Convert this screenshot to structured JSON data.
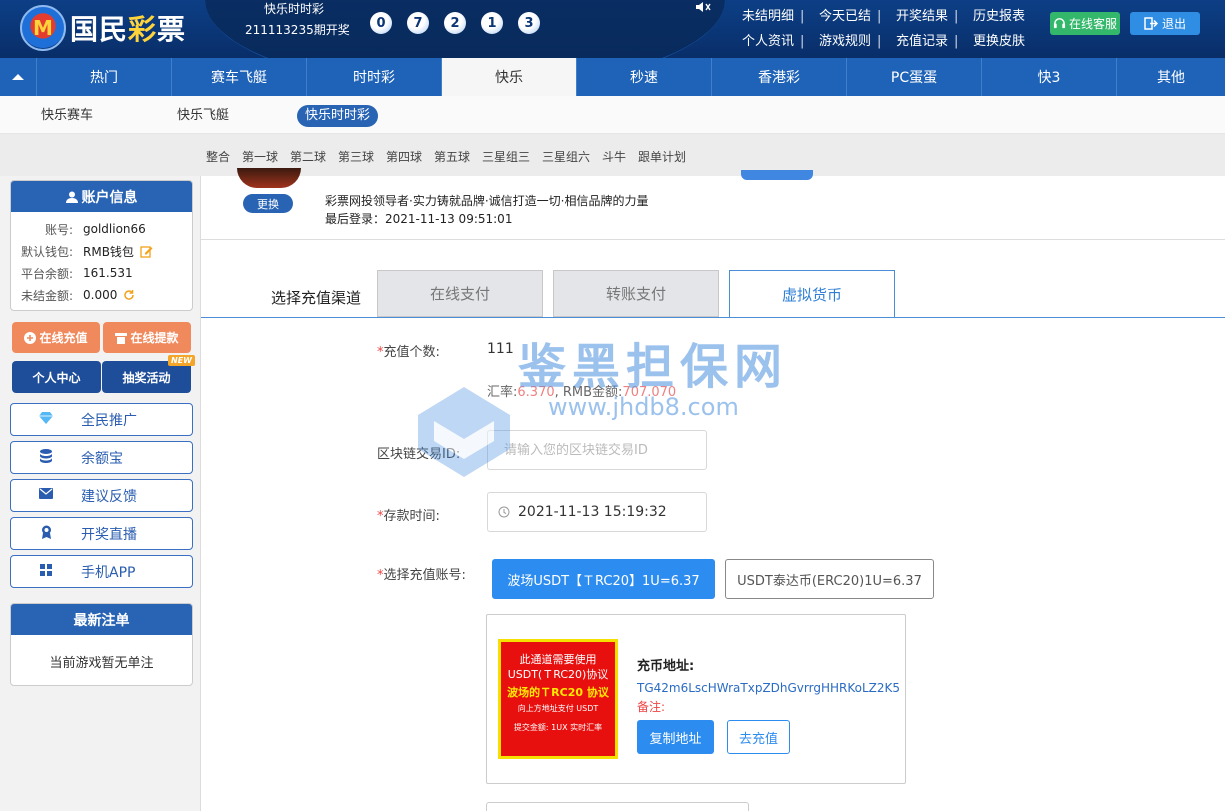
{
  "header": {
    "logo_badge": "M",
    "logo_text_a": "国民",
    "logo_text_b": "彩",
    "logo_text_c": "票",
    "lottery_name": "快乐时时彩",
    "lottery_period": "211113235期开奖",
    "balls": [
      "0",
      "7",
      "2",
      "1",
      "3"
    ],
    "links": [
      {
        "label": "未结明细"
      },
      {
        "label": "今天已结"
      },
      {
        "label": "开奖结果"
      },
      {
        "label": "历史报表"
      },
      {
        "label": "个人资讯"
      },
      {
        "label": "游戏规则"
      },
      {
        "label": "充值记录"
      },
      {
        "label": "更换皮肤"
      }
    ],
    "service_label": "在线客服",
    "logout_label": "退出",
    "colors": {
      "bg": "#0a3575",
      "service": "#33b76b",
      "logout": "#2f8de4"
    }
  },
  "mainnav": {
    "items": [
      {
        "label": "热门"
      },
      {
        "label": "赛车飞艇"
      },
      {
        "label": "时时彩"
      },
      {
        "label": "快乐"
      },
      {
        "label": "秒速"
      },
      {
        "label": "香港彩"
      },
      {
        "label": "PC蛋蛋"
      },
      {
        "label": "快3"
      },
      {
        "label": "其他"
      }
    ],
    "active": "快乐"
  },
  "subnav": {
    "items": [
      {
        "label": "快乐赛车"
      },
      {
        "label": "快乐飞艇"
      },
      {
        "label": "快乐时时彩"
      }
    ],
    "active": "快乐时时彩"
  },
  "playbar": {
    "items": [
      {
        "label": "整合"
      },
      {
        "label": "第一球"
      },
      {
        "label": "第二球"
      },
      {
        "label": "第三球"
      },
      {
        "label": "第四球"
      },
      {
        "label": "第五球"
      },
      {
        "label": "三星组三"
      },
      {
        "label": "三星组六"
      },
      {
        "label": "斗牛"
      },
      {
        "label": "跟单计划"
      }
    ]
  },
  "sidebar": {
    "account_title": "账户信息",
    "account": {
      "account_label": "账号:",
      "account_value": "goldlion66",
      "wallet_label": "默认钱包:",
      "wallet_value": "RMB钱包",
      "balance_label": "平台余额:",
      "balance_value": "161.531",
      "unsettled_label": "未结金额:",
      "unsettled_value": "0.000"
    },
    "recharge_label": "在线充值",
    "withdraw_label": "在线提款",
    "personal_label": "个人中心",
    "lottery_event_label": "抽奖活动",
    "new_badge": "NEW",
    "menu": [
      {
        "label": "全民推广",
        "icon": "diamond-icon"
      },
      {
        "label": "余额宝",
        "icon": "database-icon"
      },
      {
        "label": "建议反馈",
        "icon": "mail-icon"
      },
      {
        "label": "开奖直播",
        "icon": "award-icon"
      },
      {
        "label": "手机APP",
        "icon": "grid-icon"
      }
    ],
    "latest_title": "最新注单",
    "latest_empty": "当前游戏暂无单注"
  },
  "profile": {
    "change_label": "更换",
    "slogan": "彩票网投领导者·实力铸就品牌·诚信打造一切·相信品牌的力量",
    "last_login": "最后登录：2021-11-13 09:51:01"
  },
  "recharge": {
    "channel_label": "选择充值渠道",
    "tabs": [
      {
        "label": "在线支付"
      },
      {
        "label": "转账支付"
      },
      {
        "label": "虚拟货币"
      }
    ],
    "active_tab": "虚拟货币",
    "qty_label": "充值个数:",
    "qty_value": "111",
    "rate_prefix": "汇率:",
    "rate_value": "6.370",
    "rmb_prefix": ", RMB金额:",
    "rmb_value": "707.070",
    "txid_label": "区块链交易ID:",
    "txid_placeholder": "请输入您的区块链交易ID",
    "time_label": "存款时间:",
    "time_value": "2021-11-13 15:19:32",
    "account_label": "选择充值账号:",
    "channels": [
      {
        "label": "波场USDT【ＴRC20】1U=6.37"
      },
      {
        "label": "USDT泰达币(ERC20)1U=6.37"
      }
    ],
    "notice": {
      "line1": "此通道需要使用",
      "line2": "USDT(ＴRC20)协议",
      "line3": "波场的ＴRC20 协议",
      "line4": "向上方地址支付 USDT",
      "line5": "提交金额: 1UX 实时汇率"
    },
    "address_title": "充币地址:",
    "address_value": "TG42m6LscHWraTxpZDhGvrrgHHRKoLZ2K5",
    "remark_label": "备注:",
    "copy_label": "复制地址",
    "go_label": "去充值"
  },
  "watermark": {
    "text": "鉴黑担保网",
    "url": "www.jhdb8.com"
  }
}
